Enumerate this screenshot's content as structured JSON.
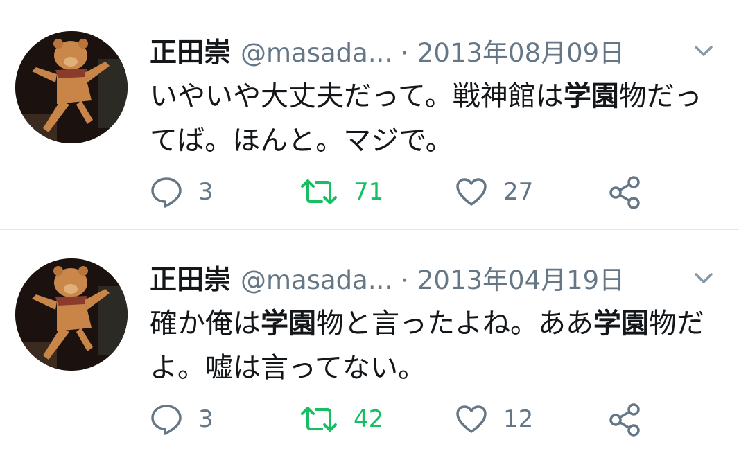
{
  "tweets": [
    {
      "name": "正田崇",
      "handle": "@masada...",
      "separator": "·",
      "date": "2013年08月09日",
      "text_parts": [
        "いやいや大丈夫だって。戦神館は",
        "学園",
        "物だってば。ほんと。マジで。"
      ],
      "replies": "3",
      "retweets": "71",
      "likes": "27"
    },
    {
      "name": "正田崇",
      "handle": "@masada...",
      "separator": "·",
      "date": "2013年04月19日",
      "text_parts": [
        "確か俺は",
        "学園",
        "物と言ったよね。ああ",
        "学園",
        "物だよ。嘘は言ってない。"
      ],
      "replies": "3",
      "retweets": "42",
      "likes": "12"
    }
  ],
  "colors": {
    "text": "#14171a",
    "muted": "#657786",
    "retweet": "#17bf63",
    "divider": "#e1e8ed"
  }
}
